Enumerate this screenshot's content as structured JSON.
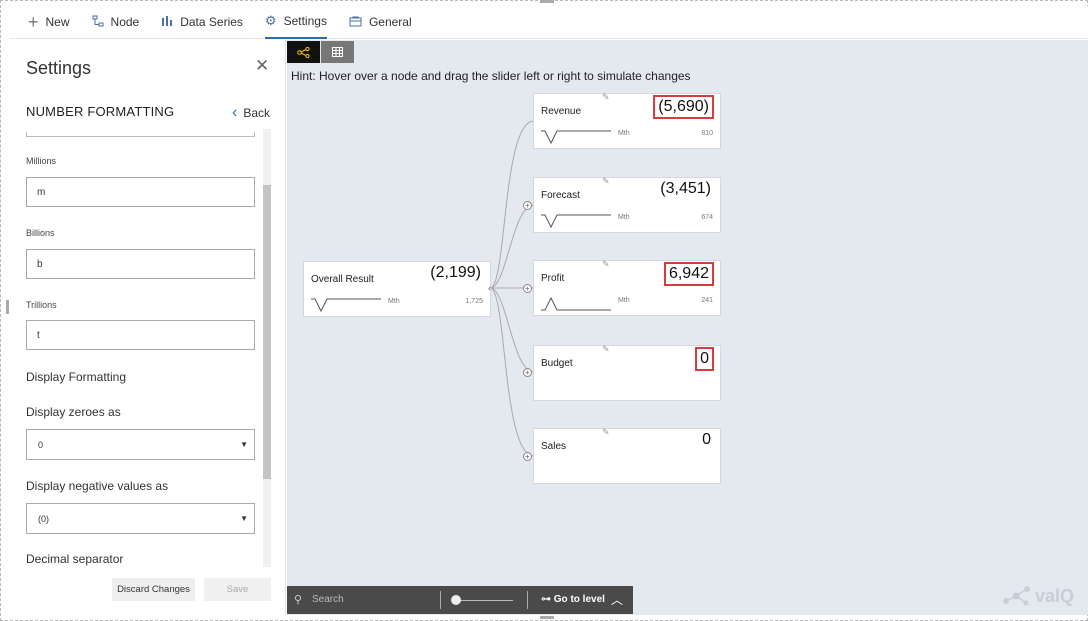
{
  "menu": {
    "items": [
      {
        "label": "New",
        "icon": "plus-icon"
      },
      {
        "label": "Node",
        "icon": "node-tree-icon"
      },
      {
        "label": "Data Series",
        "icon": "bar-chart-icon"
      },
      {
        "label": "Settings",
        "icon": "gear-icon",
        "active": true
      },
      {
        "label": "General",
        "icon": "general-icon"
      }
    ]
  },
  "settings": {
    "title": "Settings",
    "section": "NUMBER FORMATTING",
    "back_label": "Back",
    "fields": {
      "millions": {
        "label": "Millions",
        "value": "m"
      },
      "billions": {
        "label": "Billions",
        "value": "b"
      },
      "trillions": {
        "label": "Trillions",
        "value": "t"
      }
    },
    "display_formatting": "Display Formatting",
    "zeroes": {
      "label": "Display zeroes as",
      "value": "0"
    },
    "negatives": {
      "label": "Display negative values as",
      "value": "(0)"
    },
    "decimal_separator": "Decimal separator",
    "discard_label": "Discard Changes",
    "save_label": "Save"
  },
  "canvas": {
    "hint": "Hint: Hover over a node and drag the slider left or right to simulate changes",
    "nodes": {
      "overall": {
        "name": "Overall Result",
        "value": "(2,199)",
        "period": "Mth",
        "number": "1,725"
      },
      "revenue": {
        "name": "Revenue",
        "value": "(5,690)",
        "period": "Mth",
        "number": "810",
        "highlighted": true
      },
      "forecast": {
        "name": "Forecast",
        "value": "(3,451)",
        "period": "Mth",
        "number": "674",
        "highlighted": false
      },
      "profit": {
        "name": "Profit",
        "value": "6,942",
        "period": "Mth",
        "number": "241",
        "highlighted": true
      },
      "budget": {
        "name": "Budget",
        "value": "0",
        "highlighted": true
      },
      "sales": {
        "name": "Sales",
        "value": "0",
        "highlighted": false
      }
    }
  },
  "bottom": {
    "search_label": "Search",
    "goto_label": "Go to level"
  },
  "logo": {
    "text": "valQ"
  },
  "colors": {
    "highlight": "#d63c3c",
    "accent": "#2b6cb0",
    "canvas": "#e4e8ef"
  }
}
